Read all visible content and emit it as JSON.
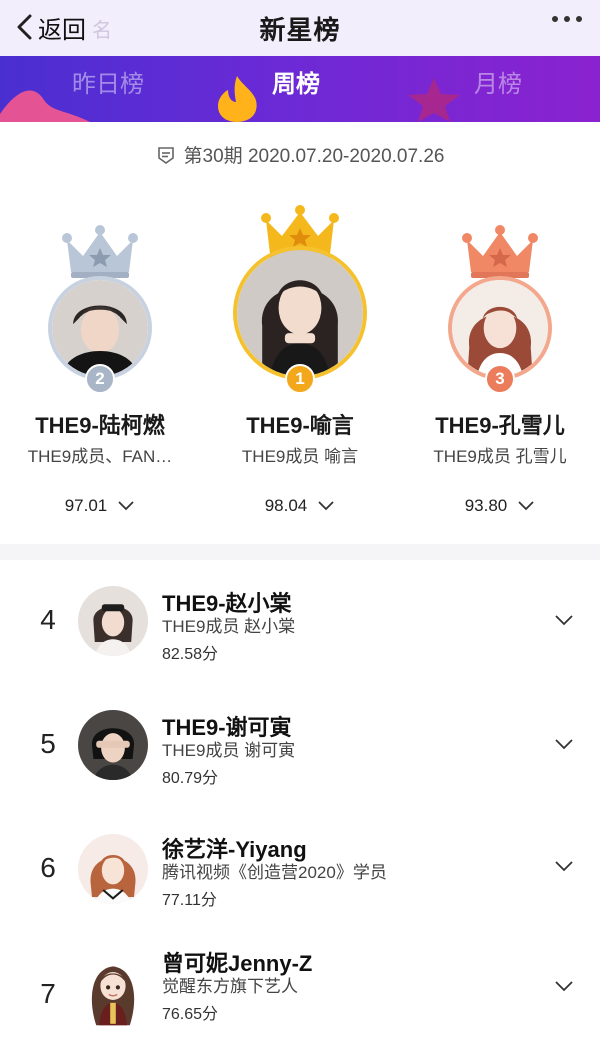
{
  "header": {
    "back_label": "返回",
    "ghost_text": "名",
    "title": "新星榜"
  },
  "tabs": [
    {
      "label": "昨日榜",
      "active": false
    },
    {
      "label": "周榜",
      "active": true
    },
    {
      "label": "月榜",
      "active": false
    }
  ],
  "period": {
    "label": "第30期 2020.07.20-2020.07.26",
    "icon": "calendar-icon"
  },
  "podium": [
    {
      "rank": "2",
      "name": "THE9-陆柯燃",
      "desc": "THE9成员、FAN…",
      "score": "97.01",
      "crown_color": "#b9c6d8",
      "badge_color": "#a9b6c8"
    },
    {
      "rank": "1",
      "name": "THE9-喻言",
      "desc": "THE9成员 喻言",
      "score": "98.04",
      "crown_color": "#f5b81c",
      "badge_color": "#f2a81a"
    },
    {
      "rank": "3",
      "name": "THE9-孔雪儿",
      "desc": "THE9成员 孔雪儿",
      "score": "93.80",
      "crown_color": "#f08866",
      "badge_color": "#ec7d5c"
    }
  ],
  "list": [
    {
      "rank": "4",
      "name": "THE9-赵小棠",
      "desc": "THE9成员 赵小棠",
      "score": "82.58分"
    },
    {
      "rank": "5",
      "name": "THE9-谢可寅",
      "desc": "THE9成员 谢可寅",
      "score": "80.79分"
    },
    {
      "rank": "6",
      "name": "徐艺洋-Yiyang",
      "desc": "腾讯视频《创造营2020》学员",
      "score": "77.11分"
    },
    {
      "rank": "7",
      "name": "曾可妮Jenny-Z",
      "desc": "觉醒东方旗下艺人",
      "score": "76.65分"
    }
  ],
  "colors": {
    "tab_gradient_start": "#4a2fd0",
    "tab_gradient_end": "#8b22cf",
    "gold": "#f5b81c",
    "silver": "#b9c6d8",
    "bronze": "#f08866"
  }
}
